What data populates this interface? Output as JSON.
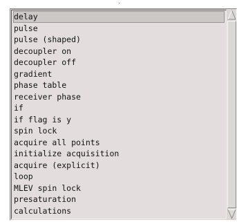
{
  "list": {
    "items": [
      {
        "label": "delay"
      },
      {
        "label": "pulse"
      },
      {
        "label": "pulse (shaped)"
      },
      {
        "label": "decoupler on"
      },
      {
        "label": "decoupler off"
      },
      {
        "label": "gradient"
      },
      {
        "label": "phase table"
      },
      {
        "label": "receiver phase"
      },
      {
        "label": "if"
      },
      {
        "label": "if flag is y"
      },
      {
        "label": "spin lock"
      },
      {
        "label": "acquire all points"
      },
      {
        "label": "initialize acquisition"
      },
      {
        "label": "acquire (explicit)"
      },
      {
        "label": "loop"
      },
      {
        "label": "MLEV spin lock"
      },
      {
        "label": "presaturation"
      },
      {
        "label": "calculations"
      }
    ],
    "selected_label": "delay"
  },
  "scrollbar": {
    "up_icon": "triangle-up-icon",
    "down_icon": "triangle-down-icon"
  },
  "colors": {
    "list_background": "#e3dedd",
    "selection": "#ccc8c6"
  }
}
